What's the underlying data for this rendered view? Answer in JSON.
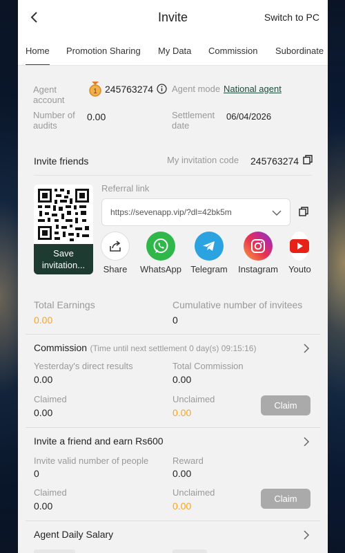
{
  "header": {
    "title": "Invite",
    "switch_pc": "Switch to PC"
  },
  "tabs": [
    {
      "label": "Home",
      "active": true
    },
    {
      "label": "Promotion Sharing"
    },
    {
      "label": "My Data"
    },
    {
      "label": "Commission"
    },
    {
      "label": "Subordinate"
    }
  ],
  "agent": {
    "account_label": "Agent account",
    "account_value": "245763274",
    "mode_label": "Agent mode",
    "mode_value": "National agent",
    "audits_label": "Number of audits",
    "audits_value": "0.00",
    "settlement_label": "Settlement date",
    "settlement_value": "06/04/2026",
    "badge_number": "1"
  },
  "invite": {
    "title": "Invite friends",
    "code_label": "My invitation code",
    "code_value": "245763274",
    "save_label": "Save invitation...",
    "referral_label": "Referral link",
    "referral_link": "https://sevenapp.vip/?dl=42bk5m",
    "share_items": [
      {
        "label": "Share",
        "icon": "share-icon"
      },
      {
        "label": "WhatsApp",
        "icon": "whatsapp-icon"
      },
      {
        "label": "Telegram",
        "icon": "telegram-icon"
      },
      {
        "label": "Instagram",
        "icon": "instagram-icon"
      },
      {
        "label": "Youto",
        "icon": "youtube-icon"
      }
    ]
  },
  "earnings": {
    "total_label": "Total Earnings",
    "total_value": "0.00",
    "invitees_label": "Cumulative number of invitees",
    "invitees_value": "0"
  },
  "commission": {
    "title": "Commission",
    "settlement_note": "(Time until next settlement  0 day(s) 09:15:16)",
    "yesterday_label": "Yesterday's direct results",
    "yesterday_value": "0.00",
    "total_label": "Total Commission",
    "total_value": "0.00",
    "claimed_label": "Claimed",
    "claimed_value": "0.00",
    "unclaimed_label": "Unclaimed",
    "unclaimed_value": "0.00",
    "claim_button": "Claim"
  },
  "invite_earn": {
    "title": "Invite a friend and earn Rs600",
    "valid_label": "Invite valid number of people",
    "valid_value": "0",
    "reward_label": "Reward",
    "reward_value": "0.00",
    "claimed_label": "Claimed",
    "claimed_value": "0.00",
    "unclaimed_label": "Unclaimed",
    "unclaimed_value": "0.00",
    "claim_button": "Claim"
  },
  "salary": {
    "title": "Agent Daily Salary"
  },
  "colors": {
    "accent_dark_green": "#1e3b31",
    "orange": "#f5a623",
    "link_green": "#1e4a3b",
    "claim_grey": "#aaaaaa"
  }
}
